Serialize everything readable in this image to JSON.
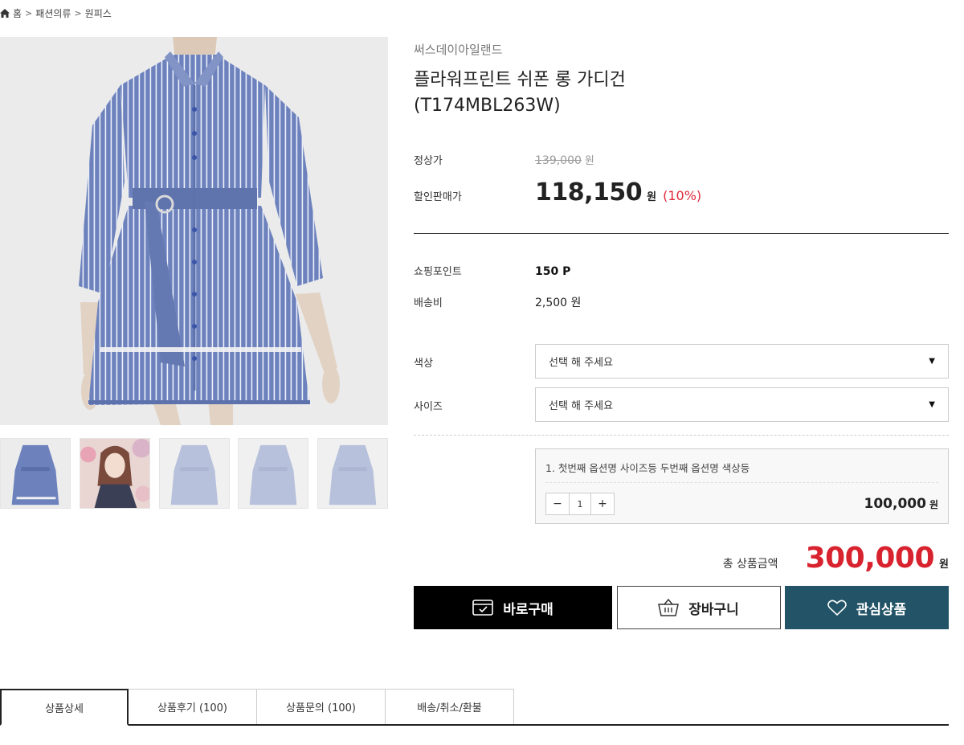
{
  "breadcrumb": {
    "items": [
      "홈",
      "패션의류",
      "원피스"
    ],
    "separator": ">"
  },
  "product": {
    "brand": "써스데이아일랜드",
    "title_line1": "플라워프린트 쉬폰 롱 가디건",
    "title_line2": "(T174MBL263W)"
  },
  "pricing": {
    "regular_label": "정상가",
    "regular_price": "139,000",
    "regular_unit": "원",
    "sale_label": "할인판매가",
    "sale_price": "118,150",
    "sale_unit": "원",
    "discount": "(10%)"
  },
  "details": {
    "points_label": "쇼핑포인트",
    "points_value": "150 P",
    "shipping_label": "배송비",
    "shipping_value": "2,500 원"
  },
  "options": {
    "color_label": "색상",
    "color_value": "선택 해 주세요",
    "size_label": "사이즈",
    "size_value": "선택 해 주세요"
  },
  "selected_option": {
    "name": "1. 첫번째 옵션명 사이즈등 두번째 옵션명 색상등",
    "minus": "−",
    "quantity": "1",
    "plus": "+",
    "price": "100,000",
    "unit": "원"
  },
  "total": {
    "label": "총 상품금액",
    "amount": "300,000",
    "unit": "원"
  },
  "actions": {
    "buy": "바로구매",
    "cart": "장바구니",
    "wish": "관심상품"
  },
  "tabs": [
    {
      "label": "상품상세"
    },
    {
      "label": "상품후기 (100)"
    },
    {
      "label": "상품문의 (100)"
    },
    {
      "label": "배송/취소/환불"
    }
  ],
  "icons": {
    "home": "home-icon",
    "buy": "card-check-icon",
    "cart": "basket-icon",
    "wish": "heart-icon",
    "dropdown": "caret-down-icon"
  },
  "colors": {
    "accent_red": "#d8222e",
    "discount_red": "#e02a3a",
    "wish_button": "#225366",
    "buy_button": "#000000",
    "dress_blue": "#6b7fb8"
  }
}
